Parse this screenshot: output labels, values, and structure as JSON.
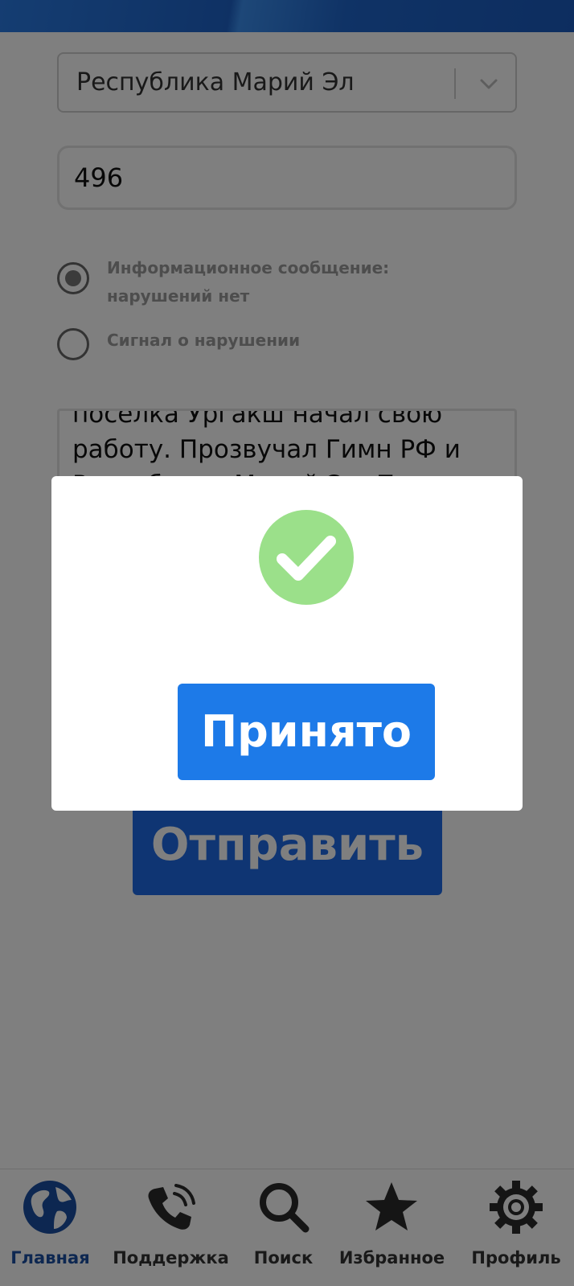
{
  "form": {
    "region_value": "Республика Марий Эл",
    "number_value": "496",
    "radio_info_label": "Информационное сообщение: нарушений нет",
    "radio_violation_label": "Сигнал о нарушении",
    "radio_selected": "info",
    "message_text": "поселка Ургакш начал свою работу. Прозвучал Гимн РФ и Республики Марий Эл. П",
    "send_label": "Отправить"
  },
  "modal": {
    "icon": "check-circle-icon",
    "accept_label": "Принято",
    "icon_color": "#9be08a"
  },
  "bottom_nav": {
    "items": [
      {
        "label": "Главная",
        "icon": "globe-icon",
        "active": true
      },
      {
        "label": "Поддержка",
        "icon": "phone-icon",
        "active": false
      },
      {
        "label": "Поиск",
        "icon": "search-icon",
        "active": false
      },
      {
        "label": "Избранное",
        "icon": "star-icon",
        "active": false
      },
      {
        "label": "Профиль",
        "icon": "gear-icon",
        "active": false
      }
    ]
  },
  "colors": {
    "primary": "#1e6ae6",
    "active_nav": "#1a4fa3"
  }
}
